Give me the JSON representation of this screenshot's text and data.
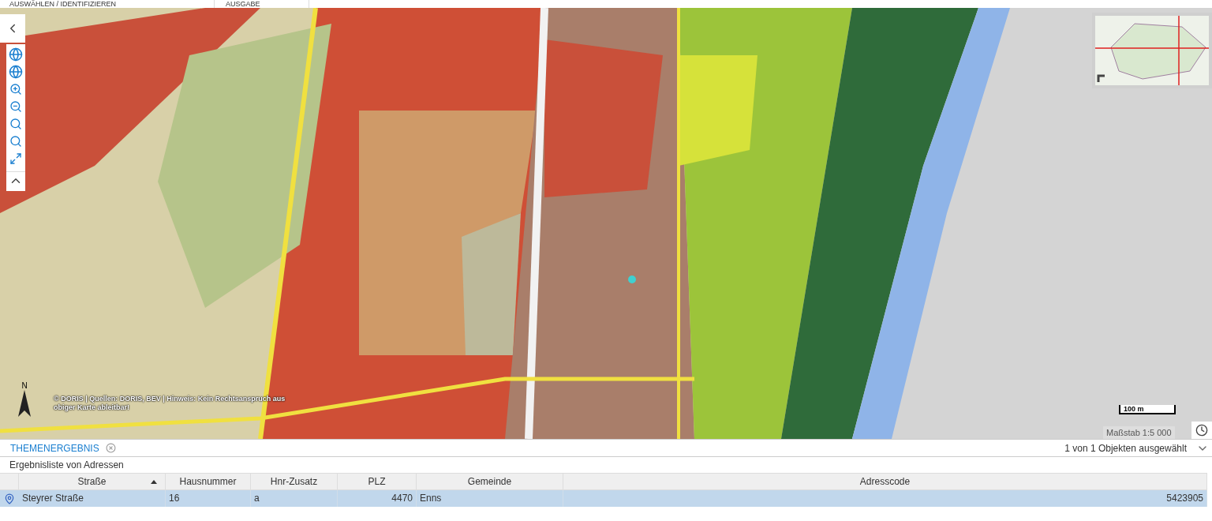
{
  "top_tabs": [
    {
      "label": "AUSWÄHLEN / IDENTIFIZIEREN",
      "selected": false
    },
    {
      "label": "AUSGABE",
      "selected": false
    }
  ],
  "map": {
    "attribution": "© DORIS | Quellen: DORIS, BEV | Hinweis: Kein Rechtsanspruch aus obiger Karte ableitbar!",
    "north_label": "N",
    "scale_bar": "100 m",
    "scale": "Maßstab 1:5 000"
  },
  "result_panel": {
    "tab": {
      "label": "THEMENERGEBNIS",
      "selected": true
    },
    "selection_info": "1 von 1 Objekten ausgewählt",
    "list_title": "Ergebnisliste von Adressen",
    "columns": [
      {
        "label": "Straße",
        "sorted": true
      },
      {
        "label": "Hausnummer",
        "sorted": false
      },
      {
        "label": "Hnr-Zusatz",
        "sorted": false
      },
      {
        "label": "PLZ",
        "sorted": false
      },
      {
        "label": "Gemeinde",
        "sorted": false
      },
      {
        "label": "Adresscode",
        "sorted": false
      }
    ],
    "rows": [
      {
        "selected": true,
        "cells": [
          "Steyrer Straße",
          "16",
          "a",
          "4470",
          "Enns",
          "5423905"
        ]
      }
    ]
  }
}
